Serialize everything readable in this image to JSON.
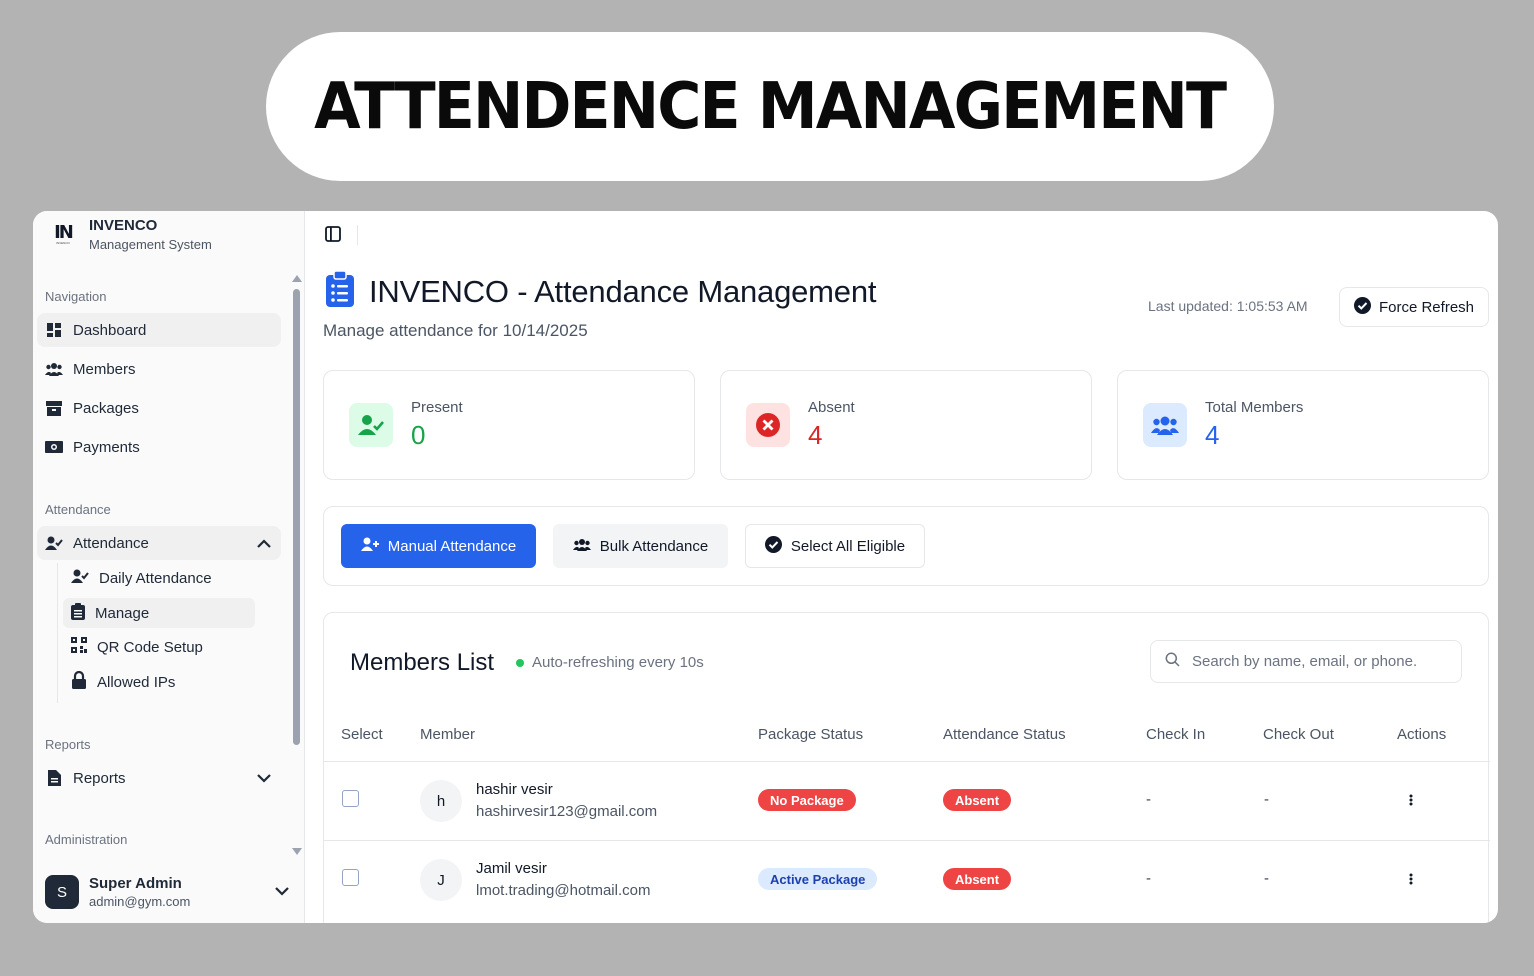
{
  "banner": {
    "title": "ATTENDENCE MANAGEMENT"
  },
  "brand": {
    "logo_text": "IN",
    "logo_sub": "INVENCO",
    "name": "INVENCO",
    "tagline": "Management System"
  },
  "sidebar": {
    "nav_label": "Navigation",
    "nav": [
      {
        "label": "Dashboard",
        "icon": "dashboard-icon"
      },
      {
        "label": "Members",
        "icon": "users-icon"
      },
      {
        "label": "Packages",
        "icon": "box-icon"
      },
      {
        "label": "Payments",
        "icon": "money-icon"
      }
    ],
    "attendance_label": "Attendance",
    "attendance_group": "Attendance",
    "attendance_items": [
      {
        "label": "Daily Attendance",
        "icon": "user-check-icon"
      },
      {
        "label": "Manage",
        "icon": "clipboard-icon"
      },
      {
        "label": "QR Code Setup",
        "icon": "qr-code-icon"
      },
      {
        "label": "Allowed IPs",
        "icon": "lock-icon"
      }
    ],
    "reports_label": "Reports",
    "reports_group": "Reports",
    "admin_label": "Administration",
    "user": {
      "initial": "S",
      "name": "Super Admin",
      "email": "admin@gym.com"
    }
  },
  "header": {
    "title": "INVENCO - Attendance Management",
    "subtitle": "Manage attendance for 10/14/2025",
    "last_updated": "Last updated: 1:05:53 AM",
    "refresh_label": "Force Refresh"
  },
  "stats": [
    {
      "label": "Present",
      "value": "0",
      "color": "#16a34a",
      "bg": "#dcfce7"
    },
    {
      "label": "Absent",
      "value": "4",
      "color": "#dc2626",
      "bg": "#fee2e2"
    },
    {
      "label": "Total Members",
      "value": "4",
      "color": "#2563eb",
      "bg": "#dbeafe"
    }
  ],
  "actions": {
    "manual": "Manual Attendance",
    "bulk": "Bulk Attendance",
    "select_all": "Select All Eligible"
  },
  "members": {
    "title": "Members List",
    "auto_refresh": "Auto-refreshing every 10s",
    "search_placeholder": "Search by name, email, or phone.",
    "columns": [
      "Select",
      "Member",
      "Package Status",
      "Attendance Status",
      "Check In",
      "Check Out",
      "Actions"
    ],
    "rows": [
      {
        "initial": "h",
        "name": "hashir vesir",
        "email": "hashirvesir123@gmail.com",
        "package": "No Package",
        "attendance": "Absent",
        "check_in": "-",
        "check_out": "-"
      },
      {
        "initial": "J",
        "name": "Jamil vesir",
        "email": "lmot.trading@hotmail.com",
        "package": "Active Package",
        "attendance": "Absent",
        "check_in": "-",
        "check_out": "-"
      }
    ]
  },
  "colors": {
    "primary": "#2563eb",
    "danger": "#ef4444",
    "success": "#16a34a"
  }
}
